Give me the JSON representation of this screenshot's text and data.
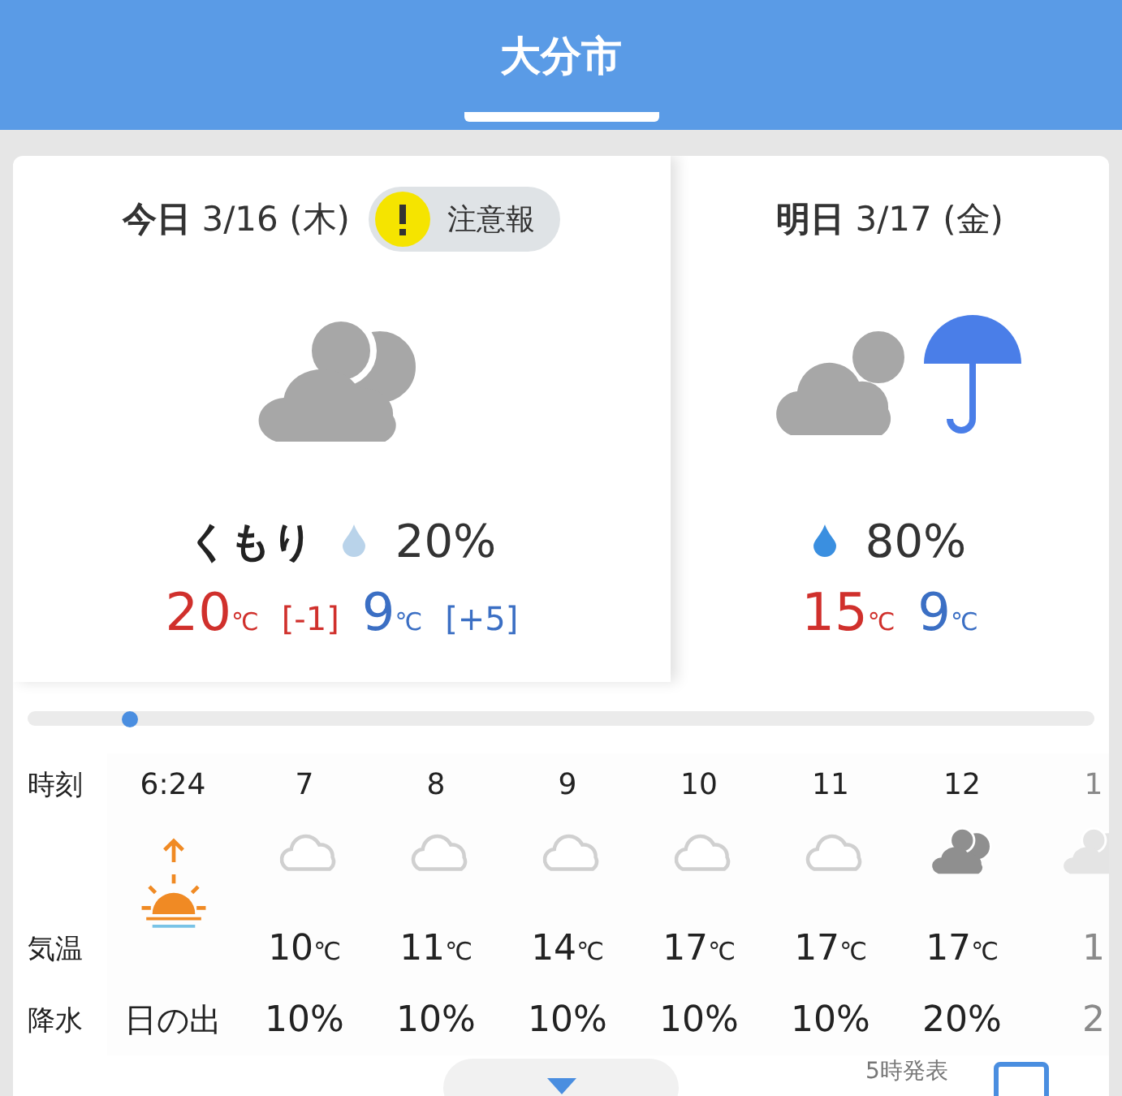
{
  "city_tab": {
    "label": "大分市",
    "selected": true
  },
  "days": [
    {
      "kind": "today",
      "day_label": "今日",
      "date": "3/16 (木)",
      "alert": {
        "label": "注意報"
      },
      "condition": "くもり",
      "precip": "20%",
      "high": {
        "value": "20",
        "unit": "℃",
        "diff": "[-1]"
      },
      "low": {
        "value": "9",
        "unit": "℃",
        "diff": "[+5]"
      }
    },
    {
      "kind": "tomorrow",
      "day_label": "明日",
      "date": "3/17 (金)",
      "precip": "80%",
      "high": {
        "value": "15",
        "unit": "℃"
      },
      "low": {
        "value": "9",
        "unit": "℃"
      }
    }
  ],
  "timeline": {
    "level": 0.096
  },
  "hourly": {
    "row_labels": [
      "時刻",
      "気温",
      "降水"
    ],
    "hours": [
      {
        "kind": "sunrise",
        "time": "6:24",
        "precip": "日の出",
        "faded": false
      },
      {
        "kind": "cloud",
        "time": "7",
        "temp": "10",
        "unit": "℃",
        "precip": "10%",
        "faded": false
      },
      {
        "kind": "cloud",
        "time": "8",
        "temp": "11",
        "unit": "℃",
        "precip": "10%",
        "faded": false
      },
      {
        "kind": "cloud",
        "time": "9",
        "temp": "14",
        "unit": "℃",
        "precip": "10%",
        "faded": false
      },
      {
        "kind": "cloud",
        "time": "10",
        "temp": "17",
        "unit": "℃",
        "precip": "10%",
        "faded": false
      },
      {
        "kind": "cloud",
        "time": "11",
        "temp": "17",
        "unit": "℃",
        "precip": "10%",
        "faded": false
      },
      {
        "kind": "sun_cloud",
        "time": "12",
        "temp": "17",
        "unit": "℃",
        "precip": "20%",
        "faded": false
      },
      {
        "kind": "sun_cloud",
        "time": "1",
        "temp": "1",
        "precip": "2",
        "faded": true
      }
    ]
  },
  "footer": {
    "issued": "5時発表"
  }
}
